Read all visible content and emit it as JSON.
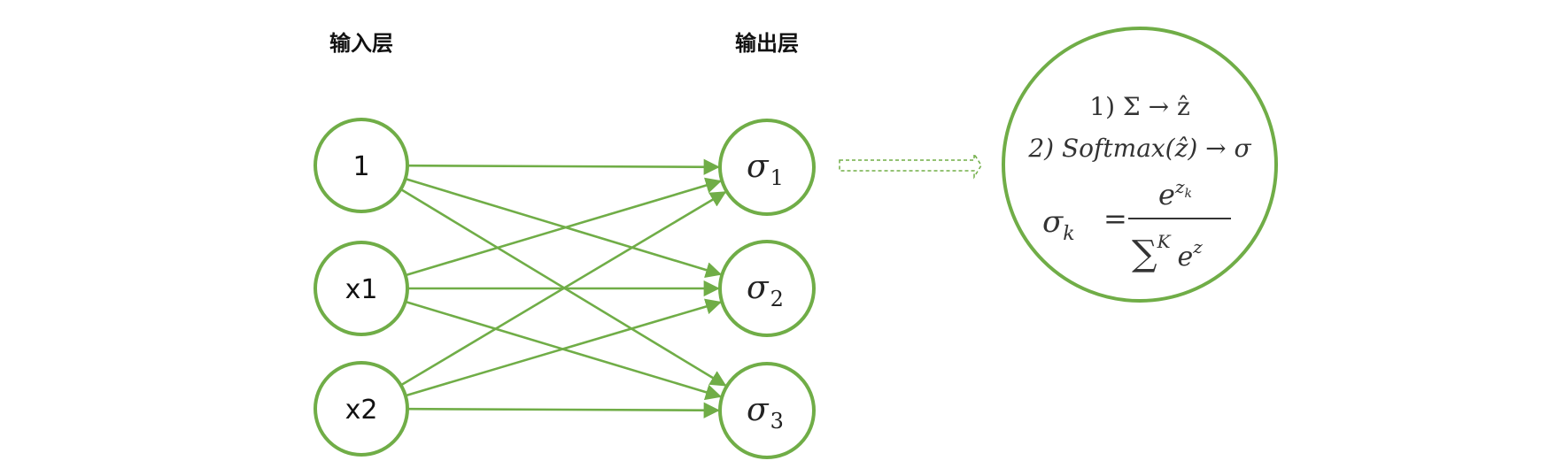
{
  "colors": {
    "accent": "#70ad47",
    "text": "#111111"
  },
  "layers": {
    "input_title": "输入层",
    "output_title": "输出层"
  },
  "inputs": [
    {
      "label": "1"
    },
    {
      "label": "x1"
    },
    {
      "label": "x2"
    }
  ],
  "outputs": [
    {
      "symbol": "σ",
      "subscript": "1"
    },
    {
      "symbol": "σ",
      "subscript": "2"
    },
    {
      "symbol": "σ",
      "subscript": "3"
    }
  ],
  "formula": {
    "line1": "1) Σ → ẑ",
    "line2": "2) Softmax(ẑ) → σ",
    "lhs_symbol": "σ",
    "lhs_subscript": "k",
    "equals": "=",
    "numerator_base": "e",
    "numerator_exp": "z",
    "numerator_exp_sub": "k",
    "denominator_sum": "∑",
    "denominator_sum_sup": "K",
    "denominator_base": "e",
    "denominator_exp": "z"
  }
}
